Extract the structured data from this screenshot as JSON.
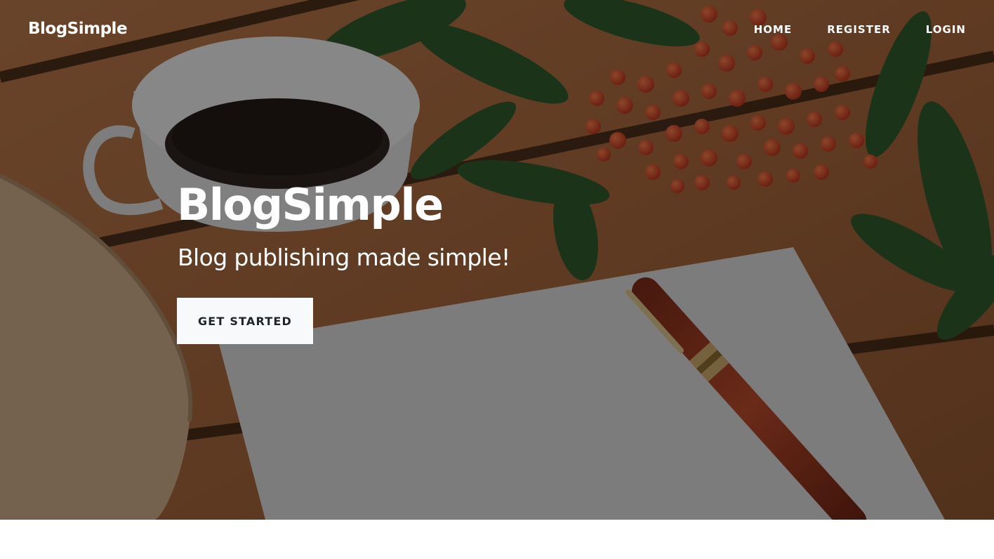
{
  "navbar": {
    "brand": "BlogSimple",
    "links": [
      {
        "label": "HOME"
      },
      {
        "label": "REGISTER"
      },
      {
        "label": "LOGIN"
      }
    ]
  },
  "hero": {
    "title": "BlogSimple",
    "subtitle": "Blog publishing made simple!",
    "cta_label": "GET STARTED",
    "image_subject": "coffee cup, red berries, leaves, blank paper and fountain pen on wooden table"
  },
  "colors": {
    "overlay": "#000000",
    "text": "#ffffff",
    "button_bg": "#f8f9fa",
    "button_text": "#212529"
  }
}
